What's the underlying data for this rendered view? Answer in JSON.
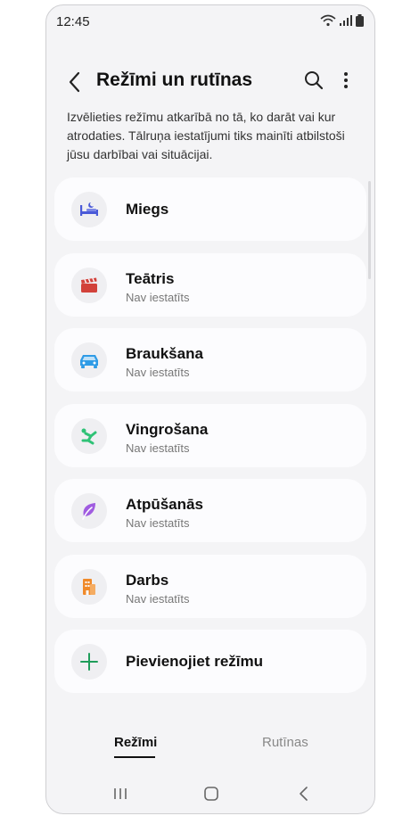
{
  "status_bar": {
    "time": "12:45"
  },
  "header": {
    "title": "Režīmi un rutīnas"
  },
  "description": "Izvēlieties režīmu atkarībā no tā, ko darāt vai kur atrodaties. Tālruņa iestatījumi tiks mainīti atbilstoši jūsu darbībai vai situācijai.",
  "modes": [
    {
      "name": "Miegs",
      "status": "",
      "icon": "bed-icon",
      "color": "#4a5ad8"
    },
    {
      "name": "Teātris",
      "status": "Nav iestatīts",
      "icon": "clapperboard-icon",
      "color": "#d2413a"
    },
    {
      "name": "Braukšana",
      "status": "Nav iestatīts",
      "icon": "car-icon",
      "color": "#2f9be6"
    },
    {
      "name": "Vingrošana",
      "status": "Nav iestatīts",
      "icon": "exercise-icon",
      "color": "#2fc276"
    },
    {
      "name": "Atpūšanās",
      "status": "Nav iestatīts",
      "icon": "leaf-icon",
      "color": "#a05ce0"
    },
    {
      "name": "Darbs",
      "status": "Nav iestatīts",
      "icon": "building-icon",
      "color": "#f08a2a"
    }
  ],
  "add_mode": {
    "label": "Pievienojiet režīmu",
    "icon": "plus-icon",
    "color": "#1f9d5a"
  },
  "tabs": [
    {
      "label": "Režīmi",
      "active": true
    },
    {
      "label": "Rutīnas",
      "active": false
    }
  ]
}
